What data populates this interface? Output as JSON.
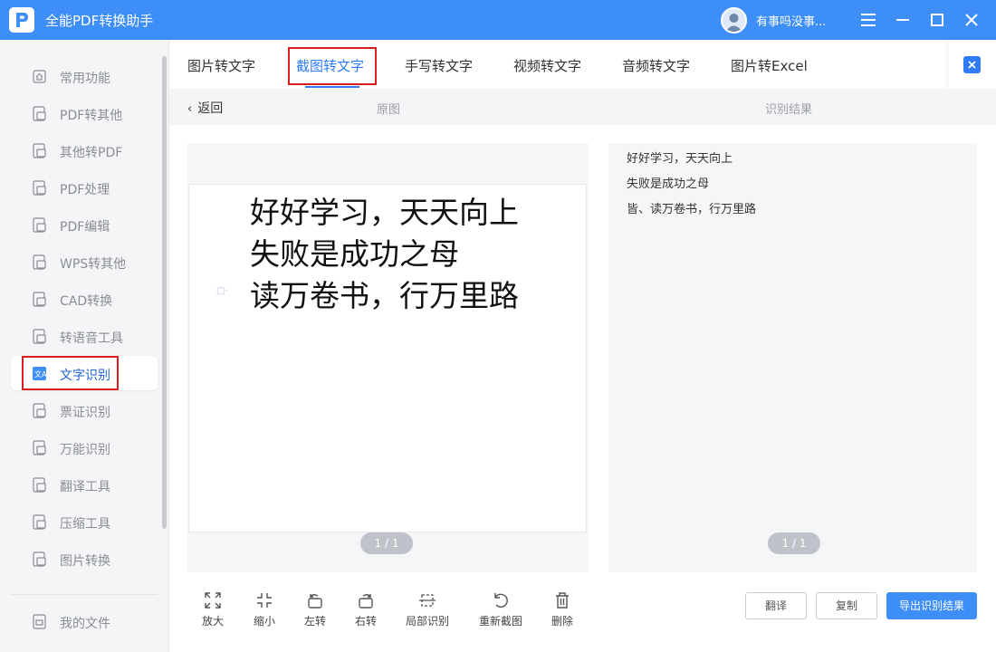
{
  "app": {
    "title": "全能PDF转换助手",
    "user_name": "有事吗没事...",
    "accent_color": "#3e8ef7"
  },
  "sidebar": {
    "items": [
      {
        "label": "常用功能",
        "icon": "home-grid-icon"
      },
      {
        "label": "PDF转其他",
        "icon": "pdf-convert-icon"
      },
      {
        "label": "其他转PDF",
        "icon": "to-pdf-icon"
      },
      {
        "label": "PDF处理",
        "icon": "pdf-process-icon"
      },
      {
        "label": "PDF编辑",
        "icon": "pdf-edit-icon"
      },
      {
        "label": "WPS转其他",
        "icon": "wps-icon"
      },
      {
        "label": "CAD转换",
        "icon": "cad-icon"
      },
      {
        "label": "转语音工具",
        "icon": "voice-icon"
      },
      {
        "label": "文字识别",
        "icon": "ocr-icon",
        "active": true
      },
      {
        "label": "票证识别",
        "icon": "ticket-icon"
      },
      {
        "label": "万能识别",
        "icon": "universal-scan-icon"
      },
      {
        "label": "翻译工具",
        "icon": "translate-icon"
      },
      {
        "label": "压缩工具",
        "icon": "zip-icon"
      },
      {
        "label": "图片转换",
        "icon": "image-convert-icon"
      }
    ],
    "my_files": "我的文件"
  },
  "tabs": [
    {
      "label": "图片转文字"
    },
    {
      "label": "截图转文字",
      "active": true
    },
    {
      "label": "手写转文字"
    },
    {
      "label": "视频转文字"
    },
    {
      "label": "音频转文字"
    },
    {
      "label": "图片转Excel"
    }
  ],
  "subheader": {
    "back": "返回",
    "original_title": "原图",
    "result_title": "识别结果"
  },
  "original": {
    "lines": [
      "好好学习，天天向上",
      "失败是成功之母",
      "读万卷书，行万里路"
    ],
    "page_indicator": "1 / 1"
  },
  "result": {
    "lines": [
      "好好学习，天天向上",
      "失败是成功之母",
      "皆、读万卷书，行万里路"
    ],
    "page_indicator": "1 / 1"
  },
  "toolbar": {
    "tools": [
      {
        "label": "放大",
        "icon": "zoom-in-icon"
      },
      {
        "label": "缩小",
        "icon": "zoom-out-icon"
      },
      {
        "label": "左转",
        "icon": "rotate-left-icon"
      },
      {
        "label": "右转",
        "icon": "rotate-right-icon"
      },
      {
        "label": "局部识别",
        "icon": "partial-recognize-icon"
      },
      {
        "label": "重新截图",
        "icon": "retake-screenshot-icon"
      },
      {
        "label": "删除",
        "icon": "delete-icon"
      }
    ],
    "translate": "翻译",
    "copy": "复制",
    "export": "导出识别结果"
  }
}
